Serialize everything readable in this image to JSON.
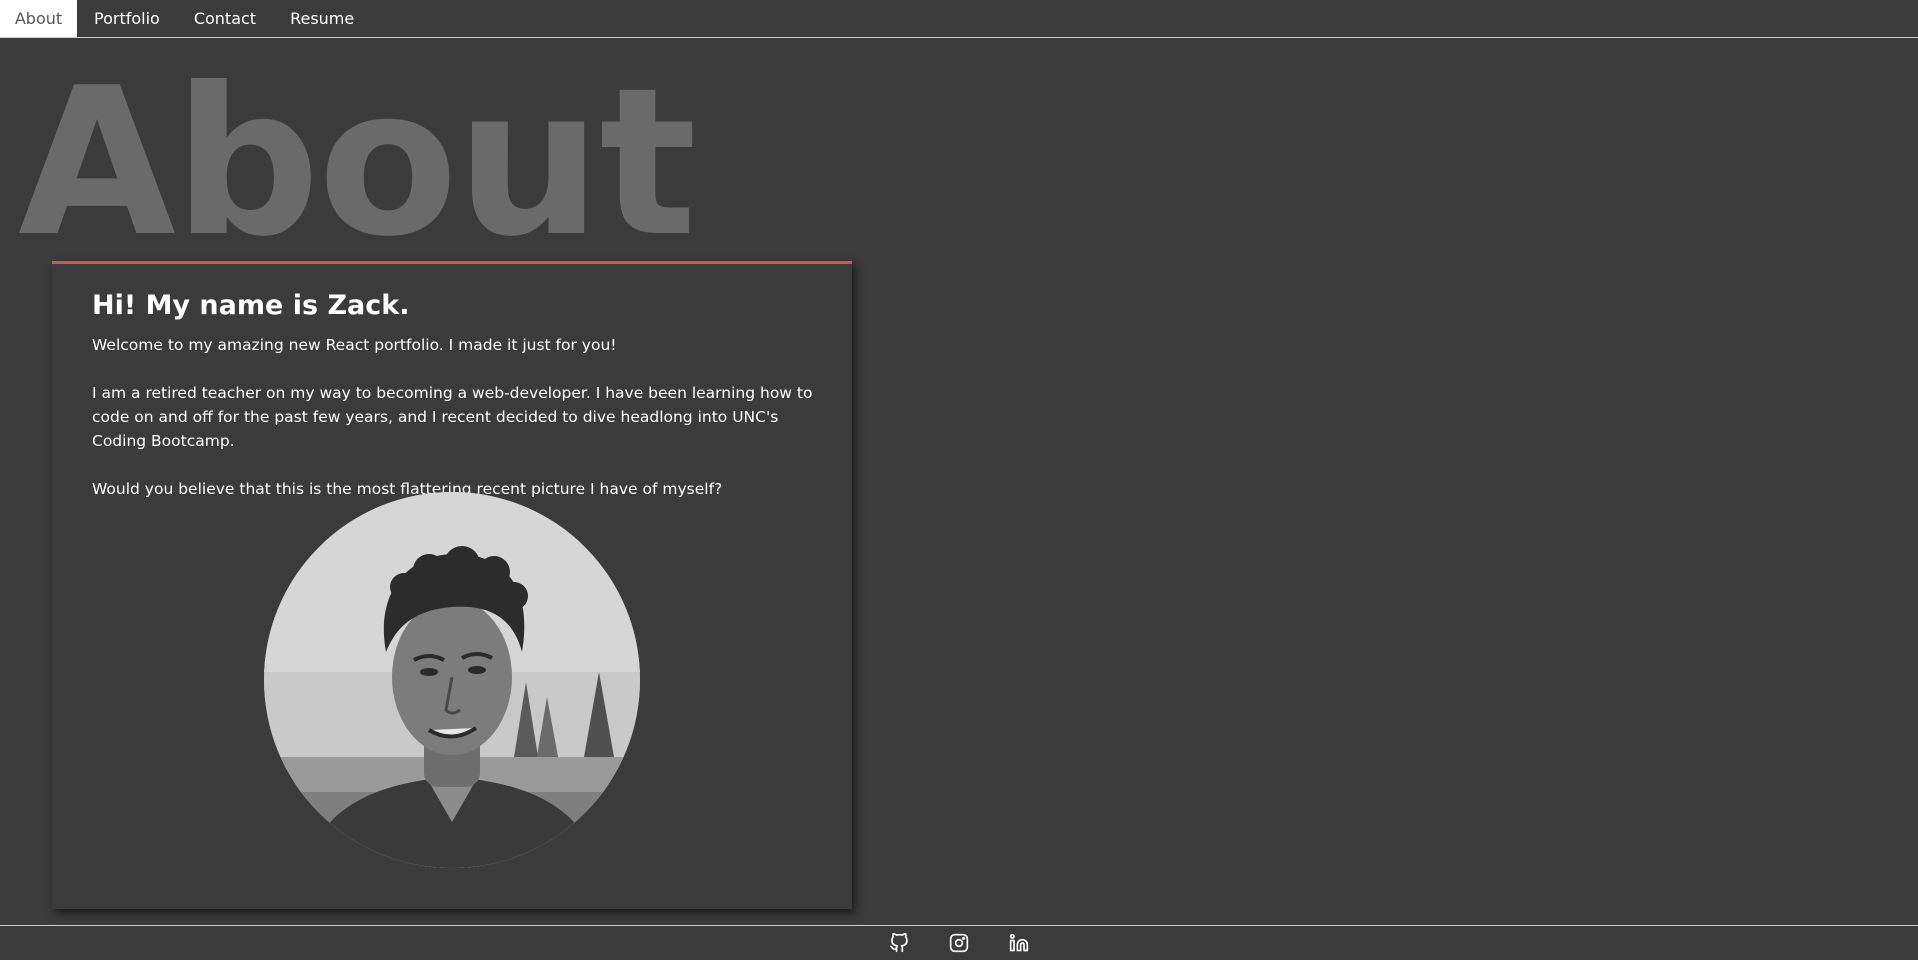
{
  "nav": {
    "tabs": [
      {
        "label": "About",
        "active": true
      },
      {
        "label": "Portfolio",
        "active": false
      },
      {
        "label": "Contact",
        "active": false
      },
      {
        "label": "Resume",
        "active": false
      }
    ]
  },
  "hero": {
    "title": "About"
  },
  "card": {
    "greeting": "Hi! My name is Zack.",
    "paragraphs": [
      "Welcome to my amazing new React portfolio. I made it just for you!",
      "I am a retired teacher on my way to becoming a web-developer. I have been learning how to code on and off for the past few years, and I recent decided to dive headlong into UNC's Coding Bootcamp.",
      "Would you believe that this is the most flattering recent picture I have of myself?"
    ],
    "accent_color": "#d9534f"
  },
  "footer": {
    "icons": [
      "github-icon",
      "instagram-icon",
      "linkedin-icon"
    ]
  }
}
